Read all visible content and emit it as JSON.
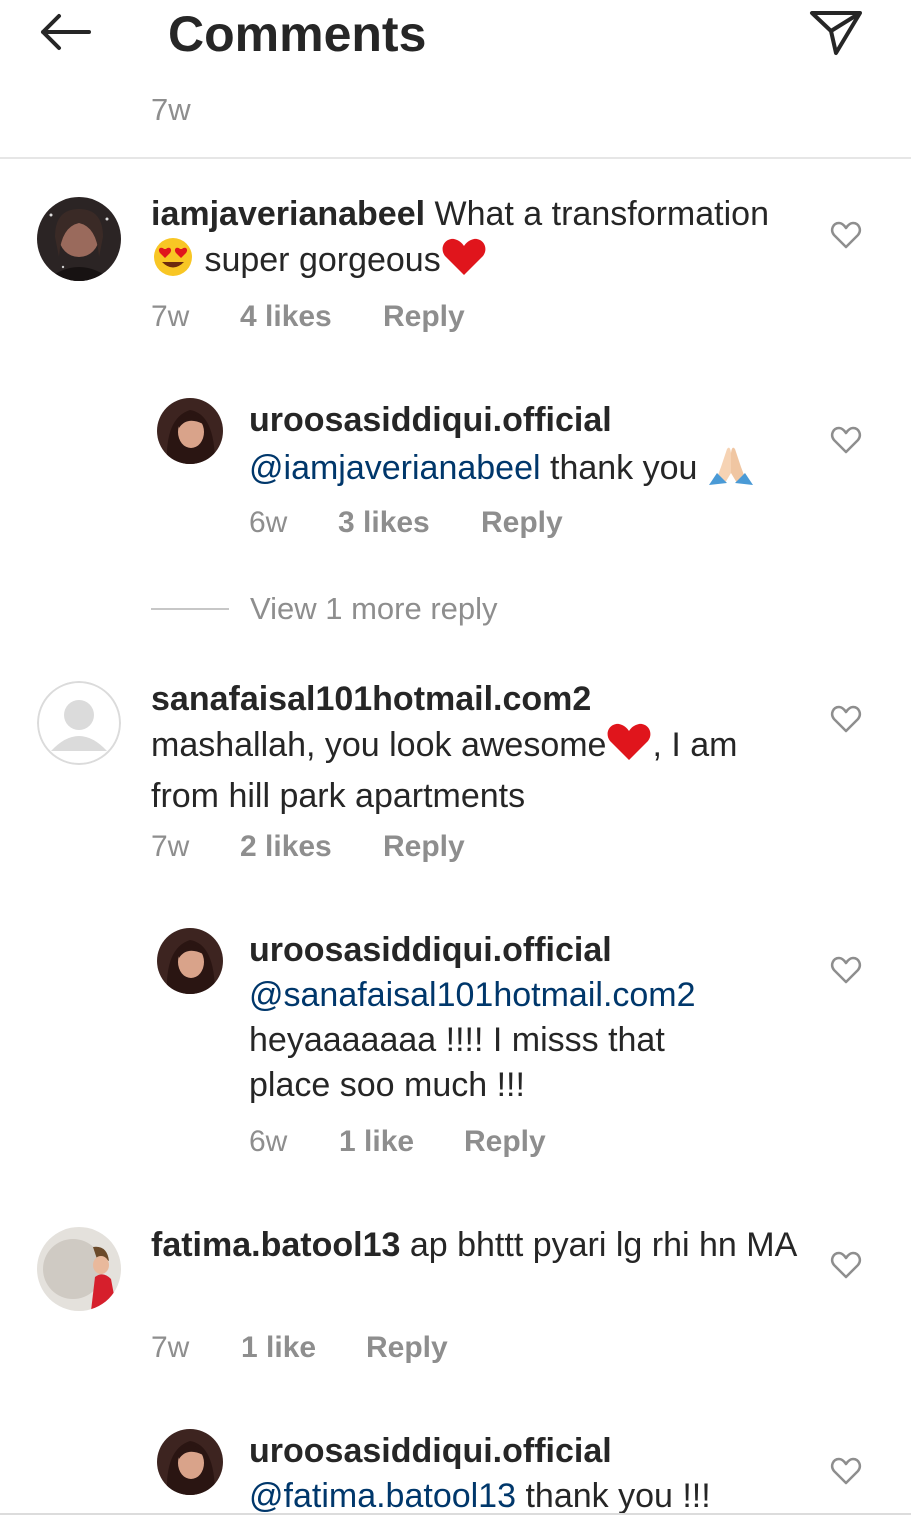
{
  "header": {
    "title": "Comments",
    "back_icon": "arrow-left-icon",
    "send_icon": "paper-plane-icon"
  },
  "caption": {
    "time": "7w"
  },
  "comments": [
    {
      "username": "iamjaverianabeel",
      "text_1": " What a transformation",
      "text_2": " super gorgeous",
      "emoji_1": "heart-eyes-emoji",
      "emoji_2": "red-heart-emoji",
      "time": "7w",
      "likes": "4 likes",
      "reply": "Reply"
    },
    {
      "username": "uroosasiddiqui.official",
      "mention": "@iamjaverianabeel",
      "text_1": " thank you ",
      "emoji_1": "folded-hands-emoji",
      "time": "6w",
      "likes": "3 likes",
      "reply": "Reply"
    },
    {
      "username": "sanafaisal101hotmail.com2",
      "text_1": "mashallah, you  look awesome",
      "text_2": ", I am from hill park apartments",
      "emoji_1": "red-heart-emoji",
      "time": "7w",
      "likes": "2 likes",
      "reply": "Reply"
    },
    {
      "username": "uroosasiddiqui.official",
      "mention": "@sanafaisal101hotmail.com2",
      "text_1": "heyaaaaaaa !!!! I misss that place soo much !!!",
      "time": "6w",
      "likes": "1 like",
      "reply": "Reply"
    },
    {
      "username": "fatima.batool13",
      "text_1": " ap bhttt pyari lg rhi hn MA",
      "time": "7w",
      "likes": "1 like",
      "reply": "Reply"
    },
    {
      "username": "uroosasiddiqui.official",
      "mention": "@fatima.batool13",
      "text_1": " thank you !!!"
    }
  ],
  "view_more": {
    "label": "View 1 more reply"
  },
  "colors": {
    "text": "#262626",
    "secondary": "#8e8e8e",
    "mention": "#00376b",
    "heart_red": "#e0151c"
  }
}
